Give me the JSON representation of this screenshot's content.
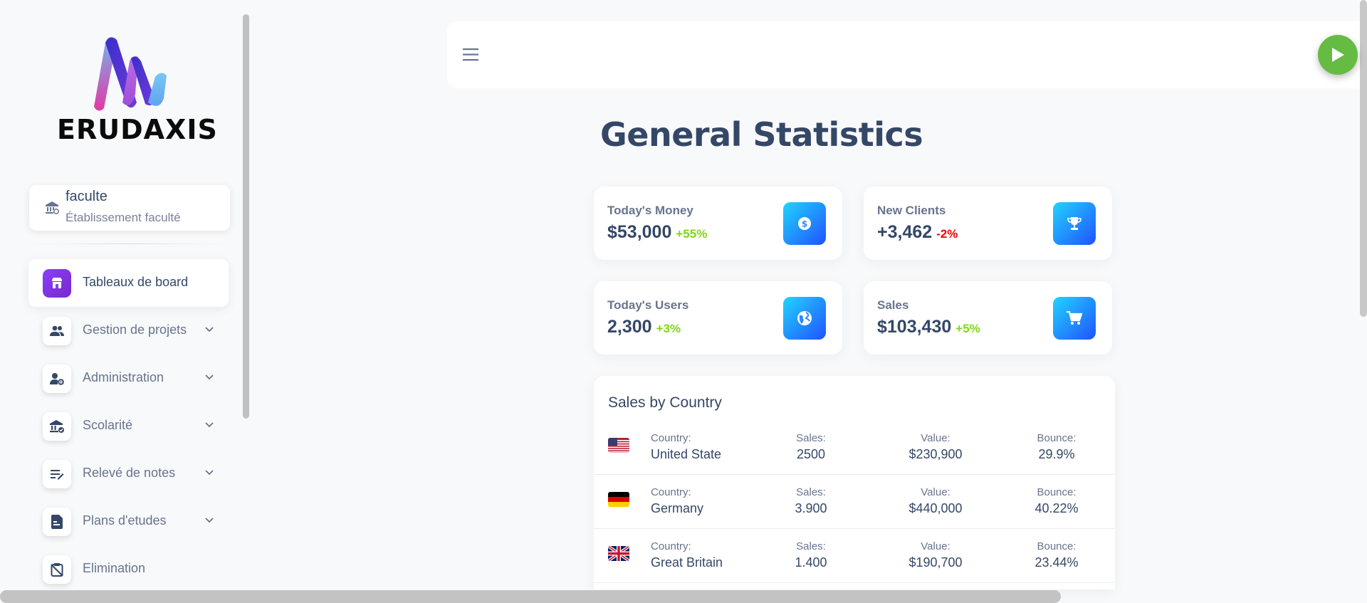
{
  "brand": {
    "name": "ERUDAXIS"
  },
  "institution": {
    "name": "faculte",
    "subtitle": "Établissement faculté",
    "icon": "bank-icon"
  },
  "sidebar": {
    "items": [
      {
        "label": "Tableaux de board",
        "icon": "shop-icon",
        "active": true,
        "has_chevron": false
      },
      {
        "label": "Gestion de projets",
        "icon": "people-icon",
        "active": false,
        "has_chevron": true
      },
      {
        "label": "Administration",
        "icon": "user-gear-icon",
        "active": false,
        "has_chevron": true
      },
      {
        "label": "Scolarité",
        "icon": "bank-check-icon",
        "active": false,
        "has_chevron": true
      },
      {
        "label": "Relevé de notes",
        "icon": "list-edit-icon",
        "active": false,
        "has_chevron": true
      },
      {
        "label": "Plans d'etudes",
        "icon": "document-icon",
        "active": false,
        "has_chevron": true
      },
      {
        "label": "Elimination",
        "icon": "clipboard-off-icon",
        "active": false,
        "has_chevron": false
      }
    ]
  },
  "header": {
    "menu_icon": "hamburger-icon",
    "action_icon": "play-icon",
    "action_color": "#66bb42"
  },
  "page": {
    "title": "General Statistics"
  },
  "stats": [
    {
      "label": "Today's Money",
      "value": "$53,000",
      "delta": "+55%",
      "trend": "up",
      "icon": "dollar-icon"
    },
    {
      "label": "New Clients",
      "value": "+3,462",
      "delta": "-2%",
      "trend": "down",
      "icon": "trophy-icon"
    },
    {
      "label": "Today's Users",
      "value": "2,300",
      "delta": "+3%",
      "trend": "up",
      "icon": "globe-icon"
    },
    {
      "label": "Sales",
      "value": "$103,430",
      "delta": "+5%",
      "trend": "up",
      "icon": "cart-icon"
    }
  ],
  "sales_by_country": {
    "title": "Sales by Country",
    "headers": {
      "country": "Country:",
      "sales": "Sales:",
      "value": "Value:",
      "bounce": "Bounce:"
    },
    "rows": [
      {
        "flag": "us-flag-icon",
        "country": "United State",
        "sales": "2500",
        "value": "$230,900",
        "bounce": "29.9%"
      },
      {
        "flag": "de-flag-icon",
        "country": "Germany",
        "sales": "3.900",
        "value": "$440,000",
        "bounce": "40.22%"
      },
      {
        "flag": "gb-flag-icon",
        "country": "Great Britain",
        "sales": "1.400",
        "value": "$190,700",
        "bounce": "23.44%"
      }
    ]
  },
  "colors": {
    "accent": "#7928ca",
    "icon_gradient_start": "#21d4fd",
    "icon_gradient_end": "#2152ff",
    "positive": "#82d616",
    "negative": "#ea0606",
    "text": "#344767"
  }
}
